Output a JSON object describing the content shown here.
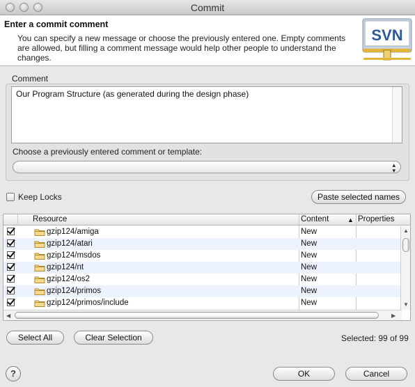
{
  "window": {
    "title": "Commit"
  },
  "header": {
    "title": "Enter a commit comment",
    "description": "You can specify a new message or choose the previously entered one. Empty comments are allowed, but filling a comment message would help other people to understand the changes.",
    "logo_text": "SVN"
  },
  "comment": {
    "group_label": "Comment",
    "value": "Our Program Structure (as generated during the design phase)",
    "template_label": "Choose a previously entered comment or template:",
    "template_selected": ""
  },
  "options": {
    "keep_locks_label": "Keep Locks",
    "keep_locks_checked": false,
    "paste_button": "Paste selected names"
  },
  "table": {
    "columns": [
      "Resource",
      "Content",
      "Properties"
    ],
    "sort_column": "Content",
    "rows": [
      {
        "resource": "gzip124/amiga",
        "content": "New",
        "properties": ""
      },
      {
        "resource": "gzip124/atari",
        "content": "New",
        "properties": ""
      },
      {
        "resource": "gzip124/msdos",
        "content": "New",
        "properties": ""
      },
      {
        "resource": "gzip124/nt",
        "content": "New",
        "properties": ""
      },
      {
        "resource": "gzip124/os2",
        "content": "New",
        "properties": ""
      },
      {
        "resource": "gzip124/primos",
        "content": "New",
        "properties": ""
      },
      {
        "resource": "gzip124/primos/include",
        "content": "New",
        "properties": ""
      }
    ]
  },
  "selection": {
    "select_all": "Select All",
    "clear_selection": "Clear Selection",
    "status": "Selected: 99 of 99"
  },
  "footer": {
    "help": "?",
    "ok": "OK",
    "cancel": "Cancel"
  }
}
